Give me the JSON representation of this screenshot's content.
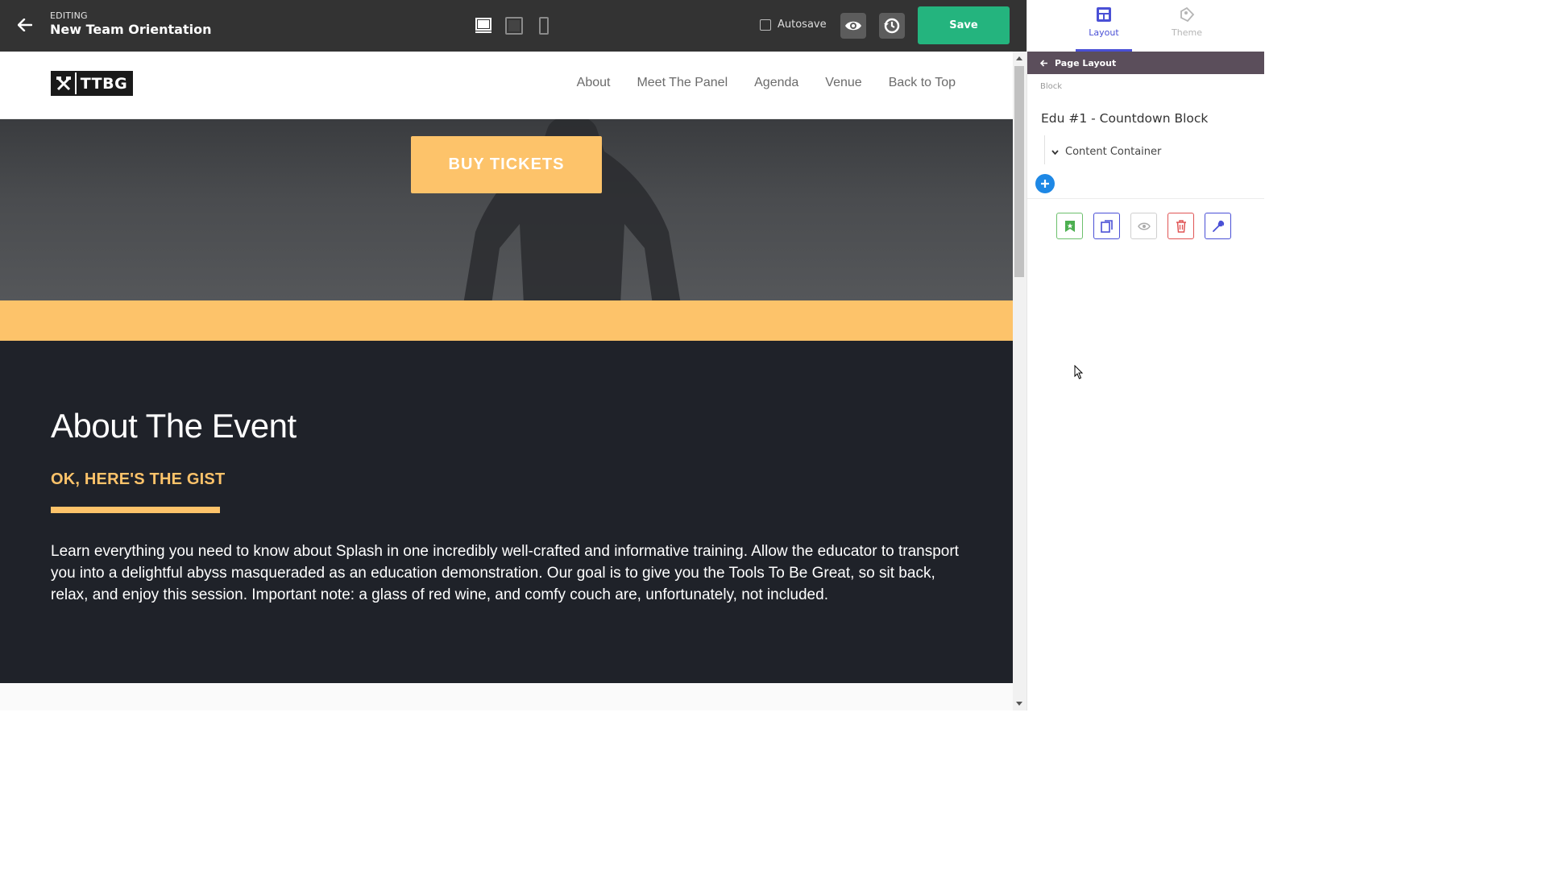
{
  "editor": {
    "editing_label": "EDITING",
    "document_title": "New Team Orientation",
    "autosave_label": "Autosave",
    "autosave_checked": false,
    "save_label": "Save",
    "devices": [
      "desktop-icon",
      "tablet-icon",
      "mobile-icon"
    ],
    "active_device": "desktop"
  },
  "site": {
    "logo_text": "TTBG",
    "nav": [
      "About",
      "Meet The Panel",
      "Agenda",
      "Venue",
      "Back to Top"
    ],
    "cta": "BUY TICKETS",
    "about": {
      "heading": "About The Event",
      "subheading": "OK, HERE'S THE GIST",
      "body": "Learn everything you need to know about Splash in one incredibly well-crafted and informative training. Allow the educator to transport you into a delightful abyss masqueraded as an education demonstration. Our goal is to give you the Tools To Be Great, so sit back, relax, and enjoy this session. Important note: a glass of red wine, and comfy couch are, unfortunately, not included."
    }
  },
  "panel": {
    "tabs": [
      {
        "label": "Layout",
        "icon": "layout-icon",
        "active": true
      },
      {
        "label": "Theme",
        "icon": "theme-icon",
        "active": false
      }
    ],
    "breadcrumb": "Page Layout",
    "section_label": "Block",
    "block_title": "Edu #1 - Countdown Block",
    "tree_item": "Content Container",
    "actions": [
      "bookmark-icon",
      "duplicate-icon",
      "visibility-icon",
      "delete-icon",
      "settings-wrench-icon"
    ]
  },
  "colors": {
    "accent_yellow": "#fdc36a",
    "save_green": "#24b47e",
    "dark_section": "#1f2229",
    "panel_accent": "#4a50d6",
    "breadcrumb_bg": "#5b4e5b"
  }
}
